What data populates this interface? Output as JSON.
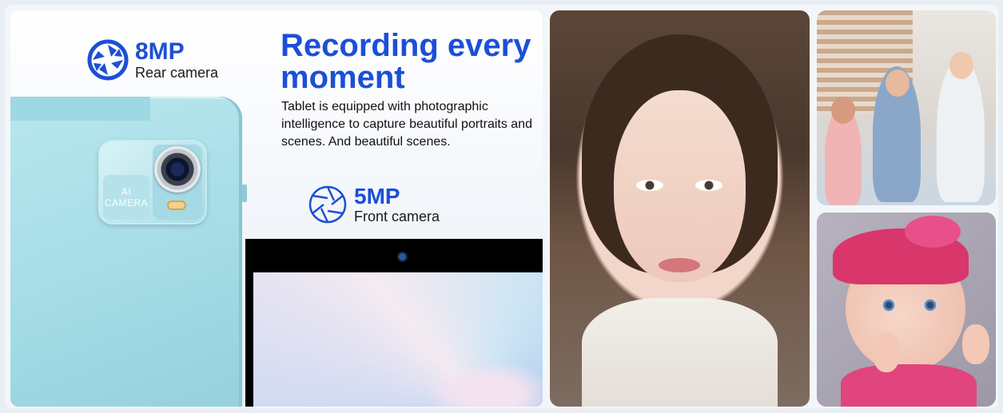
{
  "rear_camera": {
    "spec": "8MP",
    "label": "Rear camera",
    "icon": "camera-shutter-icon"
  },
  "front_camera": {
    "spec": "5MP",
    "label": "Front camera",
    "icon": "camera-shutter-icon"
  },
  "headline": "Recording every moment",
  "body": "Tablet is equipped with photographic intelligence to capture beautiful portraits and scenes. And beautiful scenes.",
  "camera_module_label": "AI CAMERA",
  "colors": {
    "accent_blue": "#1d4fd6",
    "tablet_teal": "#a6dde7"
  }
}
